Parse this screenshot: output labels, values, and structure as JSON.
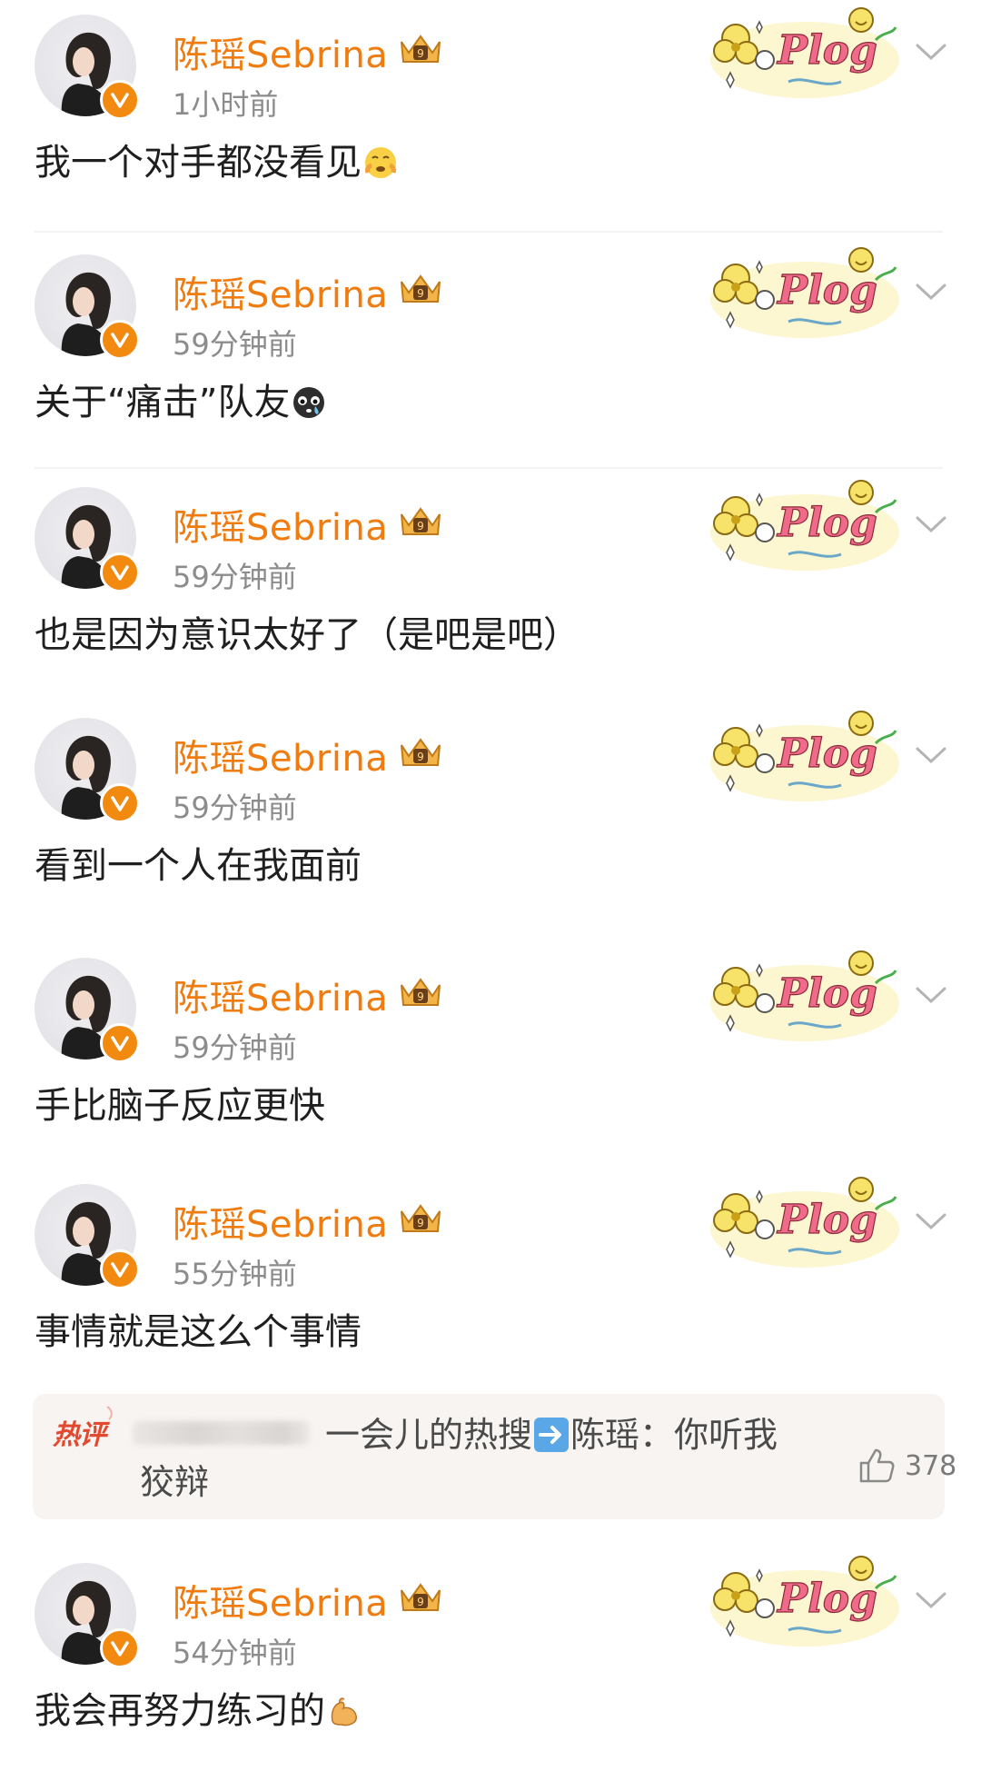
{
  "posts": [
    {
      "username": "陈瑶Sebrina",
      "time": "1小时前",
      "content": "我一个对手都没看见",
      "emoji": "crying-face-emoji"
    },
    {
      "username": "陈瑶Sebrina",
      "time": "59分钟前",
      "content": "关于“痛击”队友",
      "emoji": "tearful-face-emoji"
    },
    {
      "username": "陈瑶Sebrina",
      "time": "59分钟前",
      "content": "也是因为意识太好了（是吧是吧）",
      "emoji": ""
    },
    {
      "username": "陈瑶Sebrina",
      "time": "59分钟前",
      "content": "看到一个人在我面前",
      "emoji": ""
    },
    {
      "username": "陈瑶Sebrina",
      "time": "59分钟前",
      "content": "手比脑子反应更快",
      "emoji": ""
    },
    {
      "username": "陈瑶Sebrina",
      "time": "55分钟前",
      "content": "事情就是这么个事情",
      "emoji": ""
    },
    {
      "username": "陈瑶Sebrina",
      "time": "54分钟前",
      "content": "我会再努力练习的",
      "emoji": "flexed-biceps-emoji"
    }
  ],
  "hot_comment": {
    "tag": "热评",
    "line1": "一会儿的热搜",
    "line1_after_arrow": "陈瑶：你听我",
    "line2": "狡辩",
    "like_count": "378",
    "arrow_icon": "right-arrow-emoji"
  },
  "decorations": {
    "sticker_text": "Plog",
    "colors": {
      "username": "#f07b0e",
      "verified": "#f28a10",
      "hot_tag": "#e3492f",
      "sticker_pink": "#f06a8a",
      "sticker_yellow": "#f7e36a"
    }
  }
}
